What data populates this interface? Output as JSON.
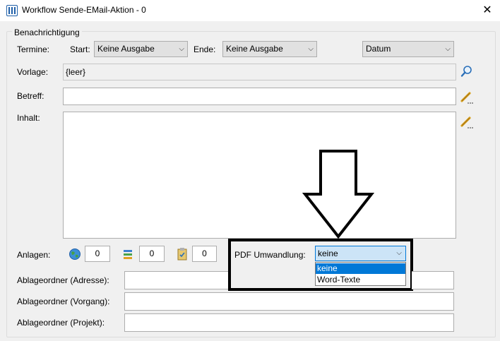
{
  "window": {
    "title": "Workflow Sende-EMail-Aktion - 0",
    "close_glyph": "✕"
  },
  "group": {
    "title": "Benachrichtigung"
  },
  "termine": {
    "label": "Termine:",
    "start_label": "Start:",
    "start_value": "Keine Ausgabe",
    "ende_label": "Ende:",
    "ende_value": "Keine Ausgabe",
    "format_value": "Datum"
  },
  "vorlage": {
    "label": "Vorlage:",
    "value": "{leer}"
  },
  "betreff": {
    "label": "Betreff:",
    "value": ""
  },
  "inhalt": {
    "label": "Inhalt:",
    "value": ""
  },
  "anlagen": {
    "label": "Anlagen:",
    "count1": "0",
    "count2": "0",
    "count3": "0"
  },
  "pdf": {
    "label": "PDF Umwandlung:",
    "value": "keine",
    "options": [
      "keine",
      "Word-Texte"
    ]
  },
  "ablage": {
    "adresse_label": "Ablageordner (Adresse):",
    "vorgang_label": "Ablageordner (Vorgang):",
    "projekt_label": "Ablageordner (Projekt):"
  },
  "icons": {
    "app": "workflow-app-icon",
    "search": "magnifier-icon",
    "edit": "pencil-icon",
    "globe": "globe-icon",
    "docs": "documents-icon",
    "task": "task-icon",
    "arrow": "down-arrow-annotation"
  },
  "colors": {
    "highlight": "#0078d7",
    "combo_bg": "#e1e1e1",
    "annotation": "#000000"
  }
}
